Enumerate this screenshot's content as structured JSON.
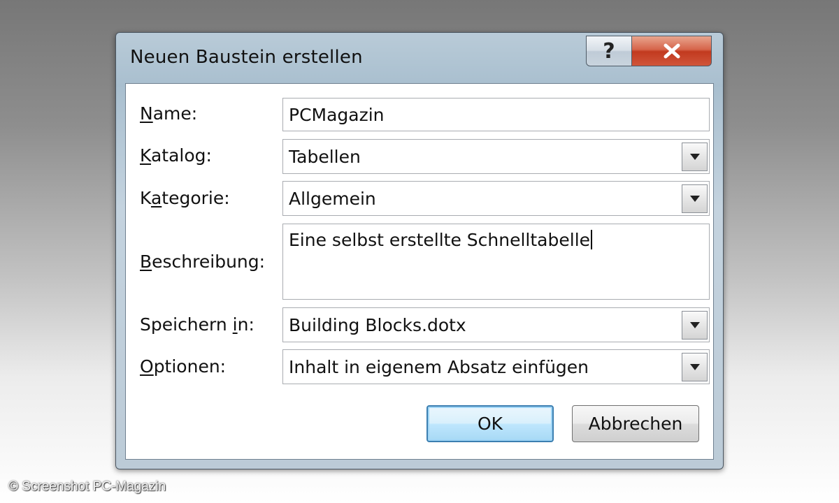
{
  "dialog": {
    "title": "Neuen Baustein erstellen",
    "help_label": "?",
    "close_icon": "close-icon"
  },
  "form": {
    "name": {
      "accel": "N",
      "rest": "ame:",
      "value": "PCMagazin"
    },
    "catalog": {
      "accel": "K",
      "rest": "atalog:",
      "value": "Tabellen"
    },
    "category": {
      "pre": "K",
      "accel": "a",
      "rest": "tegorie:",
      "value": "Allgemein"
    },
    "description": {
      "accel": "B",
      "rest": "eschreibung:",
      "value": "Eine selbst erstellte Schnelltabelle"
    },
    "save_in": {
      "pre": "Speichern ",
      "accel": "i",
      "rest": "n:",
      "value": "Building Blocks.dotx"
    },
    "options": {
      "accel": "O",
      "rest": "ptionen:",
      "value": "Inhalt in eigenem Absatz einfügen"
    }
  },
  "buttons": {
    "ok": "OK",
    "cancel": "Abbrechen"
  },
  "credit": "© Screenshot PC-Magazin",
  "colors": {
    "close_button": "#c23a1f",
    "ok_border": "#3c7fb1",
    "dialog_frame": "#b9cbd8"
  }
}
